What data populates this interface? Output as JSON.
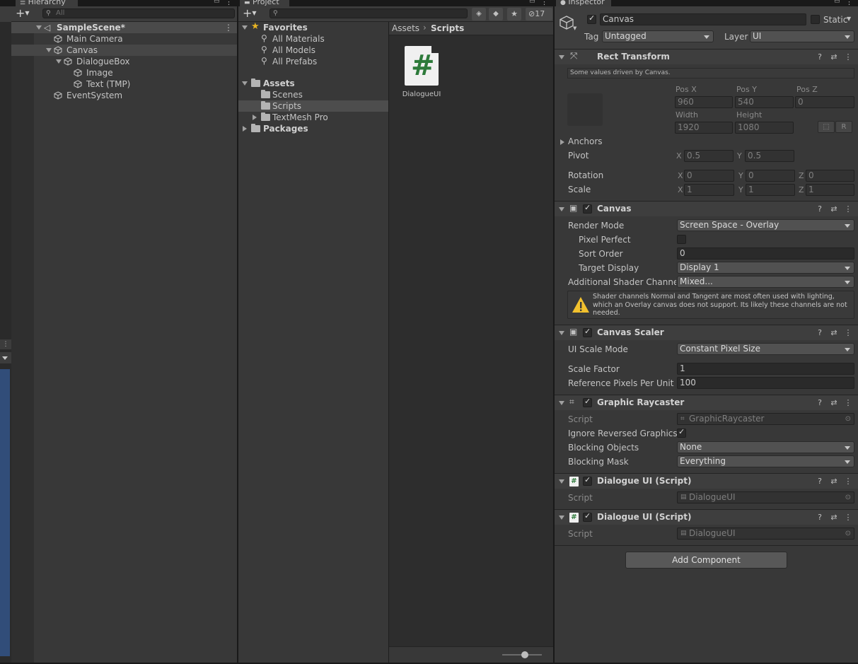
{
  "hierarchy": {
    "tab": "Hierarchy",
    "search_placeholder": "All",
    "scene": "SampleScene*",
    "items": [
      {
        "label": "Main Camera"
      },
      {
        "label": "Canvas"
      },
      {
        "label": "DialogueBox"
      },
      {
        "label": "Image"
      },
      {
        "label": "Text (TMP)"
      },
      {
        "label": "EventSystem"
      }
    ]
  },
  "project": {
    "tab": "Project",
    "hidden_count": "17",
    "favorites": {
      "label": "Favorites",
      "items": [
        "All Materials",
        "All Models",
        "All Prefabs"
      ]
    },
    "assets": {
      "label": "Assets",
      "items": [
        "Scenes",
        "Scripts",
        "TextMesh Pro"
      ]
    },
    "packages": "Packages",
    "breadcrumb": [
      "Assets",
      "Scripts"
    ],
    "files": [
      {
        "name": "DialogueUI",
        "glyph": "#"
      }
    ]
  },
  "inspector": {
    "tab": "Inspector",
    "object_name": "Canvas",
    "static_label": "Static",
    "tag_label": "Tag",
    "tag_value": "Untagged",
    "layer_label": "Layer",
    "layer_value": "UI",
    "rect_transform": {
      "title": "Rect Transform",
      "info": "Some values driven by Canvas.",
      "pos_x_label": "Pos X",
      "pos_x": "960",
      "pos_y_label": "Pos Y",
      "pos_y": "540",
      "pos_z_label": "Pos Z",
      "pos_z": "0",
      "width_label": "Width",
      "width": "1920",
      "height_label": "Height",
      "height": "1080",
      "r_button": "R",
      "anchors": "Anchors",
      "pivot_label": "Pivot",
      "pivot_x": "0.5",
      "pivot_y": "0.5",
      "rotation_label": "Rotation",
      "rot_x": "0",
      "rot_y": "0",
      "rot_z": "0",
      "scale_label": "Scale",
      "scale_x": "1",
      "scale_y": "1",
      "scale_z": "1",
      "x": "X",
      "y": "Y",
      "z": "Z"
    },
    "canvas": {
      "title": "Canvas",
      "render_mode_label": "Render Mode",
      "render_mode": "Screen Space - Overlay",
      "pixel_perfect_label": "Pixel Perfect",
      "sort_order_label": "Sort Order",
      "sort_order": "0",
      "target_display_label": "Target Display",
      "target_display": "Display 1",
      "shader_channels_label": "Additional Shader Channels",
      "shader_channels": "Mixed...",
      "warning": "Shader channels Normal and Tangent are most often used with lighting, which an Overlay canvas does not support. Its likely these channels are not needed."
    },
    "canvas_scaler": {
      "title": "Canvas Scaler",
      "ui_scale_mode_label": "UI Scale Mode",
      "ui_scale_mode": "Constant Pixel Size",
      "scale_factor_label": "Scale Factor",
      "scale_factor": "1",
      "ref_ppu_label": "Reference Pixels Per Unit",
      "ref_ppu": "100"
    },
    "graphic_raycaster": {
      "title": "Graphic Raycaster",
      "script_label": "Script",
      "script": "GraphicRaycaster",
      "ignore_reversed_label": "Ignore Reversed Graphics",
      "blocking_objects_label": "Blocking Objects",
      "blocking_objects": "None",
      "blocking_mask_label": "Blocking Mask",
      "blocking_mask": "Everything"
    },
    "dialogue_ui_1": {
      "title": "Dialogue UI (Script)",
      "script_label": "Script",
      "script": "DialogueUI"
    },
    "dialogue_ui_2": {
      "title": "Dialogue UI (Script)",
      "script_label": "Script",
      "script": "DialogueUI"
    },
    "add_component": "Add Component"
  },
  "colors": {
    "scene_view_blue": "#314d79",
    "script_icon_green": "#2d7a3a",
    "warning_yellow": "#f2c12e",
    "favorites_star": "#e8b423"
  }
}
